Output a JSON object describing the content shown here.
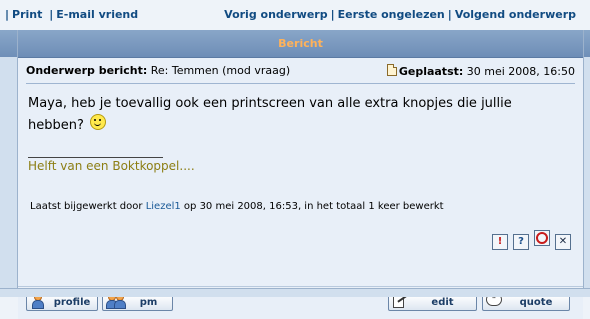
{
  "topnav": {
    "print": "Print",
    "email": "E-mail vriend",
    "prev_topic": "Vorig onderwerp",
    "first_unread": "Eerste ongelezen",
    "next_topic": "Volgend onderwerp"
  },
  "header": {
    "title": "Bericht"
  },
  "post": {
    "subject_label": "Onderwerp bericht:",
    "subject": "Re: Temmen (mod vraag)",
    "posted_label": "Geplaatst:",
    "posted_date": "30 mei 2008, 16:50",
    "message": "Maya, heb je toevallig ook een printscreen van alle extra knopjes die jullie hebben?",
    "signature": "Helft van een Boktkoppel....",
    "edited_prefix": "Laatst bijgewerkt door",
    "edited_user": "Liezel1",
    "edited_suffix": "op 30 mei 2008, 16:53, in het totaal 1 keer bewerkt"
  },
  "mod_icons": [
    {
      "name": "report",
      "glyph": "!"
    },
    {
      "name": "info",
      "glyph": "?"
    },
    {
      "name": "ban",
      "glyph": ""
    },
    {
      "name": "delete",
      "glyph": "✕"
    }
  ],
  "footer": {
    "profile": "profile",
    "pm": "pm",
    "edit": "edit",
    "quote": "quote",
    "quote_icon": "\""
  },
  "colors": {
    "header_title": "#ffb25a",
    "signature": "#8c7e13",
    "link": "#114b82"
  }
}
